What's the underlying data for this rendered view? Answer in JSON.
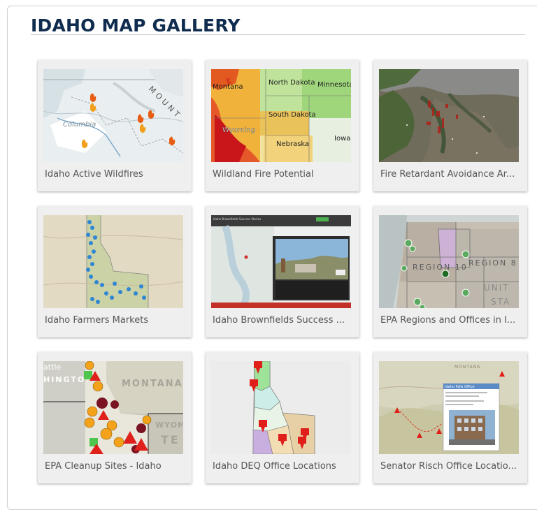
{
  "page": {
    "title": "IDAHO MAP GALLERY"
  },
  "gallery": {
    "items": [
      {
        "caption": "Idaho Active Wildfires",
        "map_labels": {
          "region": "Columbia",
          "mount": "MOUNT"
        }
      },
      {
        "caption": "Wildland Fire Potential",
        "map_labels": {
          "l1": "North Dakota",
          "l2": "Minnesota",
          "l3": "Montana",
          "l4": "South Dakota",
          "l5": "Wyoming",
          "l6": "Nebraska",
          "l7": "Iowa"
        }
      },
      {
        "caption": "Fire Retardant Avoidance Ar..."
      },
      {
        "caption": "Idaho Farmers Markets"
      },
      {
        "caption": "Idaho Brownfields Success ...",
        "map_labels": {
          "header": "Idaho Brownfields Success Stories"
        }
      },
      {
        "caption": "EPA Regions and Offices in I...",
        "map_labels": {
          "r10": "REGION 10",
          "r8": "REGION 8",
          "unit": "UNIT",
          "sta": "STA"
        }
      },
      {
        "caption": "EPA Cleanup Sites - Idaho",
        "map_labels": {
          "seattle": "attle",
          "montana": "MONTANA",
          "wyom": "WYOM",
          "te": "TE",
          "hingto": "HINGTO"
        }
      },
      {
        "caption": "Idaho DEQ Office Locations"
      },
      {
        "caption": "Senator Risch Office Locatio...",
        "map_labels": {
          "popup_title": "Idaho Falls Office",
          "montana": "MONTANA"
        }
      }
    ]
  },
  "colors": {
    "title": "#0f2c4e",
    "caption": "#555555",
    "card_bg": "#efefef"
  }
}
